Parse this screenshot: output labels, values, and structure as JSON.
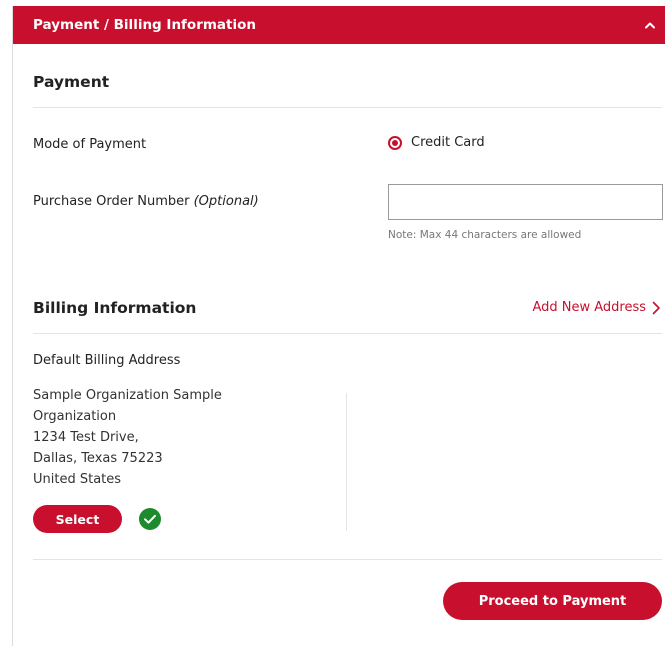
{
  "header": {
    "title": "Payment / Billing Information",
    "collapse_icon": "chevron-up-icon"
  },
  "payment": {
    "title": "Payment",
    "mode_label": "Mode of Payment",
    "mode_option": "Credit Card",
    "mode_selected": true,
    "po_label": "Purchase Order Number",
    "po_optional": "(Optional)",
    "po_value": "",
    "po_note": "Note: Max 44 characters are allowed"
  },
  "billing": {
    "title": "Billing Information",
    "add_address_label": "Add New Address",
    "add_address_icon": "chevron-right-icon",
    "default_heading": "Default Billing Address",
    "address_lines": [
      "Sample Organization Sample Organization",
      "1234 Test Drive,",
      "Dallas, Texas 75223",
      "United States"
    ],
    "select_label": "Select",
    "selected_icon": "check-circle-icon"
  },
  "footer": {
    "proceed_label": "Proceed to Payment"
  },
  "colors": {
    "brand": "#c8102e",
    "success": "#1e8a2e"
  }
}
